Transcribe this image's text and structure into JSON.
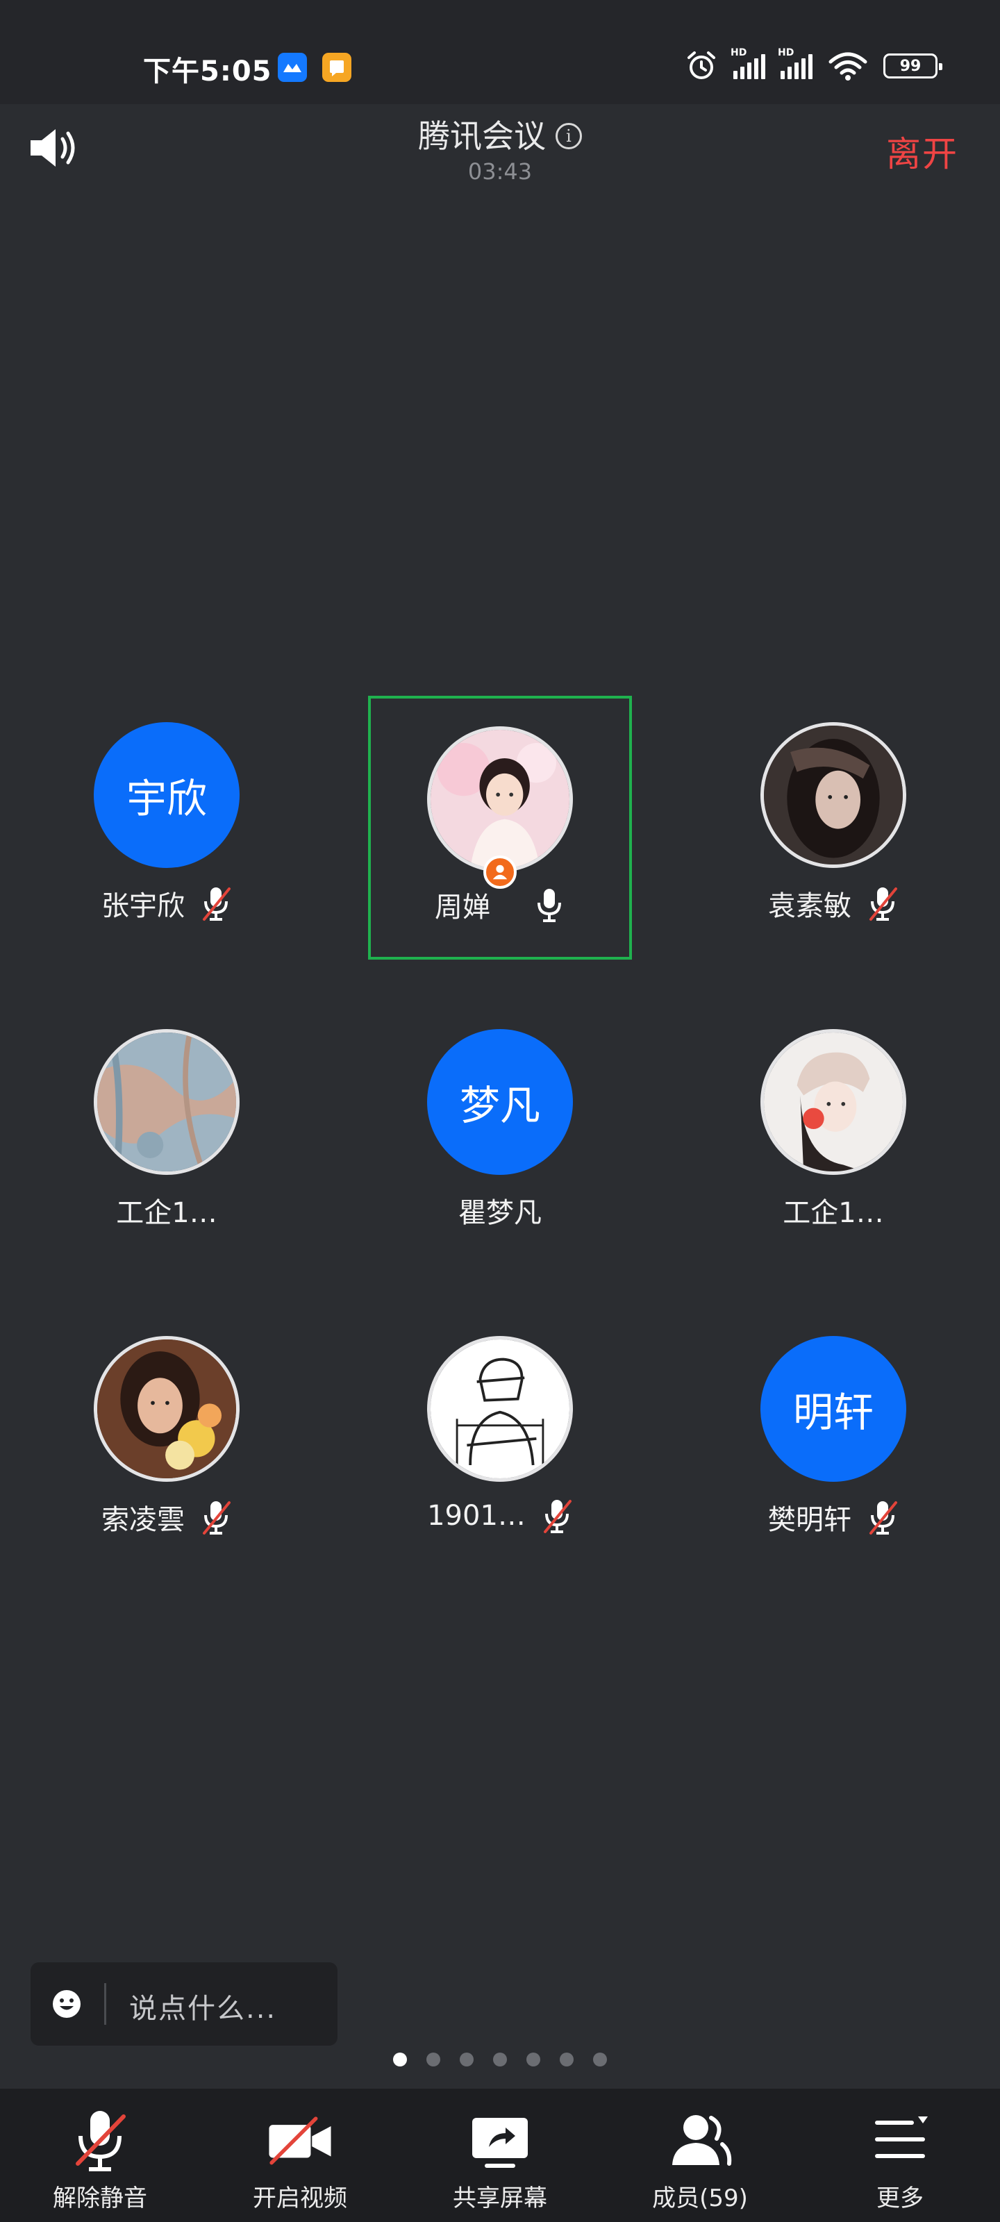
{
  "status_bar": {
    "time": "下午5:05",
    "hd_1": "HD",
    "hd_2": "HD",
    "battery": "99"
  },
  "meeting": {
    "title": "腾讯会议",
    "timer": "03:43",
    "leave_label": "离开"
  },
  "participants": [
    {
      "name": "张宇欣",
      "avatar_text": "宇欣",
      "mic": "muted"
    },
    {
      "name": "周婵",
      "avatar_text": "",
      "mic": "on",
      "is_host": true,
      "is_active": true
    },
    {
      "name": "袁素敏",
      "avatar_text": "",
      "mic": "muted"
    },
    {
      "name": "工企1…",
      "avatar_text": "",
      "mic": "none"
    },
    {
      "name": "瞿梦凡",
      "avatar_text": "梦凡",
      "mic": "none"
    },
    {
      "name": "工企1…",
      "avatar_text": "",
      "mic": "none"
    },
    {
      "name": "索凌雲",
      "avatar_text": "",
      "mic": "muted"
    },
    {
      "name": "1901…",
      "avatar_text": "",
      "mic": "muted"
    },
    {
      "name": "樊明轩",
      "avatar_text": "明轩",
      "mic": "muted"
    }
  ],
  "chat": {
    "placeholder": "说点什么..."
  },
  "pagination": {
    "total": 7,
    "current": 1
  },
  "toolbar": {
    "unmute_label": "解除静音",
    "video_label": "开启视频",
    "share_label": "共享屏幕",
    "members_label": "成员(59)",
    "more_label": "更多"
  },
  "colors": {
    "accent_blue": "#0a6dfa",
    "leave_red": "#ef4444",
    "active_border": "#1fb14e",
    "host_badge": "#f26a1b",
    "mute_slash": "#e3443a"
  }
}
